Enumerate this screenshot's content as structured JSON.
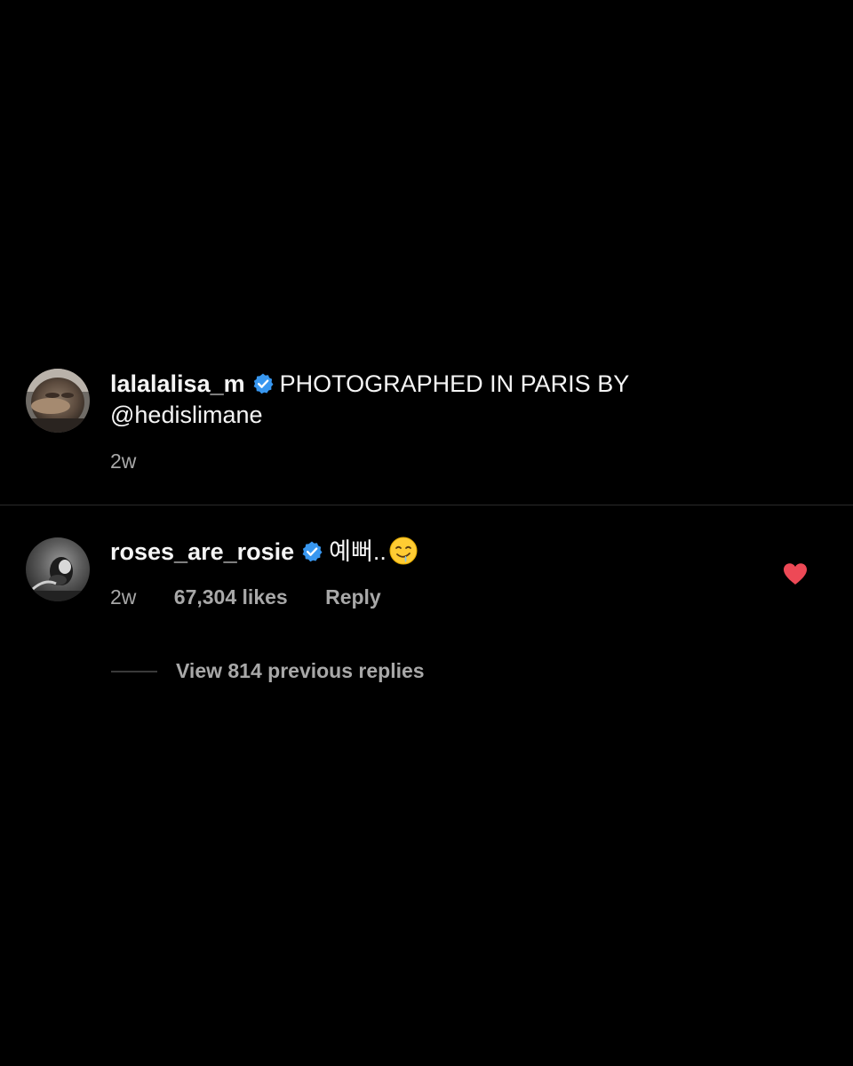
{
  "post": {
    "username": "lalalalisa_m",
    "caption_line1": "PHOTOGRAPHED IN PARIS BY",
    "caption_line2": "@hedislimane",
    "time": "2w"
  },
  "comment": {
    "username": "roses_are_rosie",
    "text": "예뻐..",
    "emoji_icon": "drooling-face-emoji",
    "time": "2w",
    "likes": "67,304 likes",
    "reply_label": "Reply",
    "liked": true
  },
  "replies": {
    "view_label": "View 814 previous replies"
  },
  "colors": {
    "background": "#000000",
    "text_primary": "#f5f5f5",
    "text_secondary": "#a8a8a8",
    "verified_blue": "#3897f0",
    "heart_red": "#ed4956",
    "divider": "#2a2a2a"
  }
}
